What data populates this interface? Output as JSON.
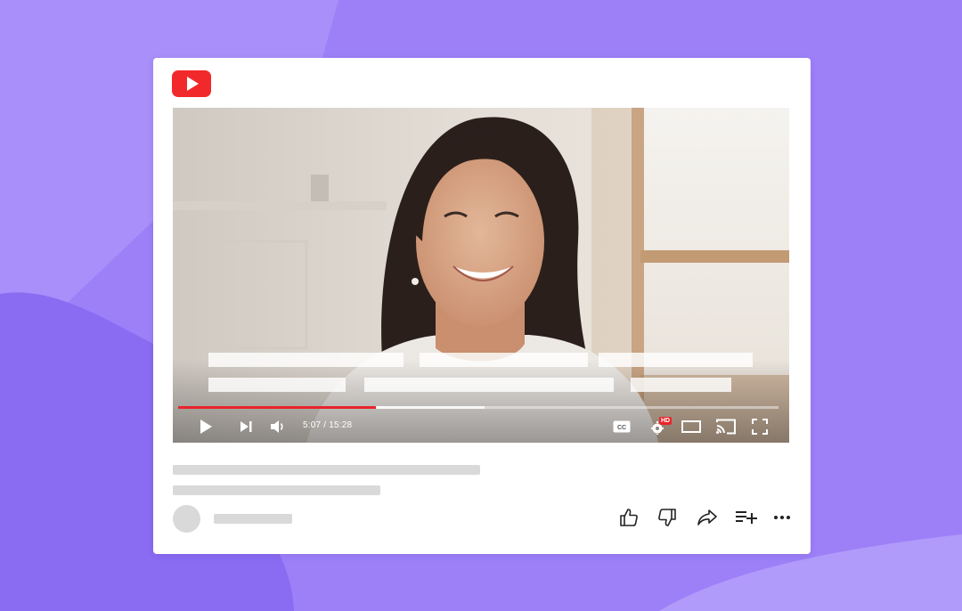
{
  "app": {
    "name": "YouTube",
    "brand_color": "#f2292b",
    "icon": "youtube-play-logo-icon"
  },
  "player": {
    "current_time": "5:07",
    "duration": "15:28",
    "time_display": "5:07 / 15:28",
    "played_fraction": 0.33,
    "buffered_fraction": 0.51,
    "progress_color": "#e8242b",
    "quality_badge": "HD",
    "controls": [
      {
        "name": "play",
        "icon": "play-icon"
      },
      {
        "name": "next",
        "icon": "skip-next-icon"
      },
      {
        "name": "volume",
        "icon": "volume-icon"
      },
      {
        "name": "captions",
        "icon": "closed-captions-icon"
      },
      {
        "name": "settings",
        "icon": "settings-gear-icon"
      },
      {
        "name": "theater",
        "icon": "theater-mode-icon"
      },
      {
        "name": "cast",
        "icon": "cast-icon"
      },
      {
        "name": "fullscreen",
        "icon": "fullscreen-icon"
      }
    ]
  },
  "actions": [
    {
      "name": "like",
      "icon": "thumbs-up-icon"
    },
    {
      "name": "dislike",
      "icon": "thumbs-down-icon"
    },
    {
      "name": "share",
      "icon": "share-arrow-icon"
    },
    {
      "name": "save",
      "icon": "add-to-playlist-icon"
    },
    {
      "name": "more",
      "icon": "more-horizontal-icon"
    }
  ],
  "colors": {
    "background": "#9d80f8",
    "card": "#ffffff",
    "placeholder": "#d9d9d9"
  }
}
